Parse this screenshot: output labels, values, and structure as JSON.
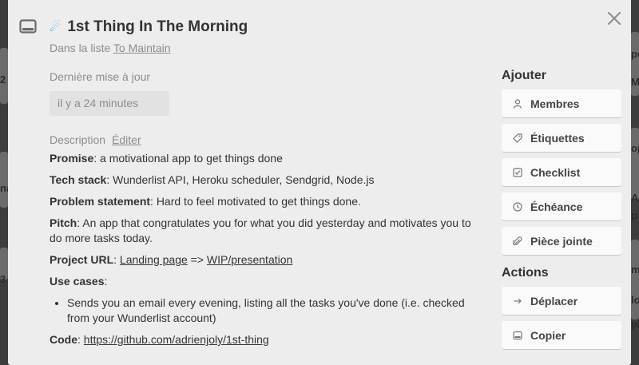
{
  "card": {
    "title": "1st Thing In The Morning",
    "title_emoji_icon": "rocket-icon",
    "in_list_prefix": "Dans la liste",
    "list_name": "To Maintain"
  },
  "updated": {
    "label": "Dernière mise à jour",
    "value": "il y a 24 minutes"
  },
  "description": {
    "label": "Description",
    "edit": "Éditer",
    "promise_label": "Promise",
    "promise_text": ": a motivational app to get things done",
    "tech_label": "Tech stack",
    "tech_text": ": Wunderlist API, Heroku scheduler, Sendgrid, Node.js",
    "problem_label": "Problem statement",
    "problem_text": ": Hard to feel motivated to get things done.",
    "pitch_label": "Pitch",
    "pitch_text": ": An app that congratulates you for what you did yesterday and motivates you to do more tasks today.",
    "url_label": "Project URL",
    "url_sep": ": ",
    "url_link1": "Landing page",
    "url_arrow": " => ",
    "url_link2": "WIP/presentation",
    "usecases_label": "Use cases",
    "usecases_colon": ":",
    "usecase_1": "Sends you an email every evening, listing all the tasks you've done (i.e. checked from your Wunderlist account)",
    "code_label": "Code",
    "code_sep": ": ",
    "code_link": "https://github.com/adrienjoly/1st-thing"
  },
  "sidebar": {
    "add_title": "Ajouter",
    "add_items": [
      {
        "label": "Membres",
        "icon": "user-icon"
      },
      {
        "label": "Étiquettes",
        "icon": "tag-icon"
      },
      {
        "label": "Checklist",
        "icon": "checkbox-icon"
      },
      {
        "label": "Échéance",
        "icon": "clock-icon"
      },
      {
        "label": "Pièce jointe",
        "icon": "paperclip-icon"
      }
    ],
    "actions_title": "Actions",
    "action_items": [
      {
        "label": "Déplacer",
        "icon": "arrow-right-icon"
      },
      {
        "label": "Copier",
        "icon": "card-icon"
      }
    ]
  },
  "background": {
    "left_fragments": [
      "2",
      "3",
      "na"
    ],
    "right_fragments": [
      "pe",
      "M",
      "op",
      "Al",
      "pi",
      "m",
      "lo",
      "pi"
    ]
  }
}
